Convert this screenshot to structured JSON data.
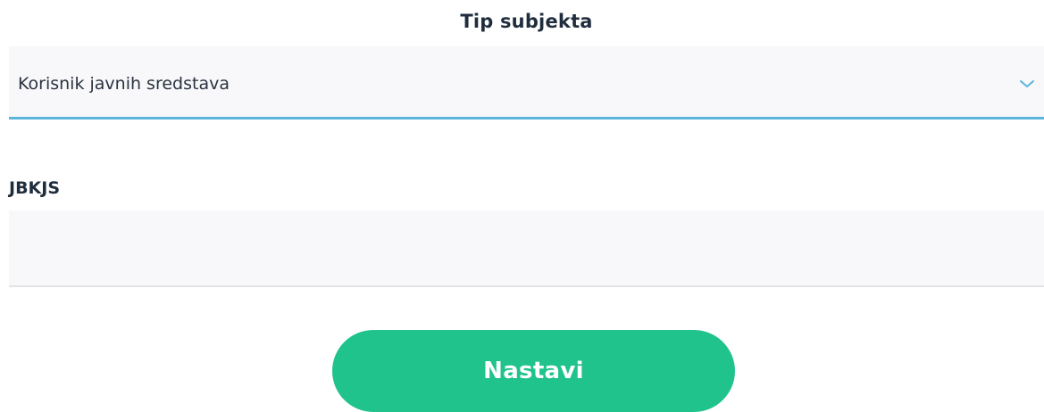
{
  "subject_type": {
    "title": "Tip subjekta",
    "selected_value": "Korisnik javnih sredstava",
    "icon": "chevron-down-icon",
    "accent_color": "#5bb5dd"
  },
  "jbkjs": {
    "label": "JBKJS",
    "value": "",
    "placeholder": ""
  },
  "submit": {
    "label": "Nastavi",
    "color": "#21c38d"
  }
}
